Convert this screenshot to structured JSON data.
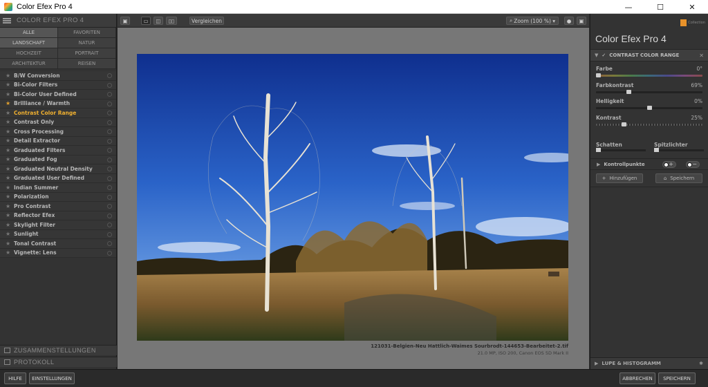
{
  "window": {
    "title": "Color Efex Pro 4",
    "minimize": "—",
    "maximize": "☐",
    "close": "✕"
  },
  "left": {
    "header": "COLOR EFEX PRO 4",
    "categories": [
      {
        "label": "ALLE",
        "active": true
      },
      {
        "label": "FAVORITEN",
        "active": false
      },
      {
        "label": "LANDSCHAFT",
        "active": true
      },
      {
        "label": "NATUR",
        "active": false
      },
      {
        "label": "HOCHZEIT",
        "active": false
      },
      {
        "label": "PORTRAIT",
        "active": false
      },
      {
        "label": "ARCHITEKTUR",
        "active": false
      },
      {
        "label": "REISEN",
        "active": false
      }
    ],
    "filters": [
      {
        "label": "B/W Conversion",
        "fav": false
      },
      {
        "label": "Bi-Color Filters",
        "fav": false
      },
      {
        "label": "Bi-Color User Defined",
        "fav": false
      },
      {
        "label": "Brilliance / Warmth",
        "fav": true
      },
      {
        "label": "Contrast Color Range",
        "fav": false,
        "selected": true
      },
      {
        "label": "Contrast Only",
        "fav": false
      },
      {
        "label": "Cross Processing",
        "fav": false
      },
      {
        "label": "Detail Extractor",
        "fav": false
      },
      {
        "label": "Graduated Filters",
        "fav": false
      },
      {
        "label": "Graduated Fog",
        "fav": false
      },
      {
        "label": "Graduated Neutral Density",
        "fav": false
      },
      {
        "label": "Graduated User Defined",
        "fav": false
      },
      {
        "label": "Indian Summer",
        "fav": false
      },
      {
        "label": "Polarization",
        "fav": false
      },
      {
        "label": "Pro Contrast",
        "fav": false
      },
      {
        "label": "Reflector Efex",
        "fav": false
      },
      {
        "label": "Skylight Filter",
        "fav": false
      },
      {
        "label": "Sunlight",
        "fav": false
      },
      {
        "label": "Tonal Contrast",
        "fav": false
      },
      {
        "label": "Vignette: Lens",
        "fav": false
      }
    ],
    "footer_recipes": "ZUSAMMENSTELLUNGEN",
    "footer_history": "PROTOKOLL"
  },
  "toolbar": {
    "compare": "Vergleichen",
    "zoom": "Zoom (100 %)"
  },
  "image": {
    "filename": "121031-Belgien-Neu Hattlich-Waimes Sourbrodt-144653-Bearbeitet-2.tif",
    "meta": "21.0 MP, ISO 200, Canon EOS 5D Mark II"
  },
  "right": {
    "badge": "Collection",
    "product": "Color Efex Pro",
    "version": "4",
    "filter_title": "CONTRAST COLOR RANGE",
    "params": [
      {
        "label": "Farbe",
        "value": "0°",
        "fraction": 0.0,
        "track": "hue"
      },
      {
        "label": "Farbkontrast",
        "value": "69%",
        "fraction": 0.3,
        "track": "plain"
      },
      {
        "label": "Helligkeit",
        "value": "0%",
        "fraction": 0.5,
        "track": "plain"
      },
      {
        "label": "Kontrast",
        "value": "25%",
        "fraction": 0.25,
        "track": "dotted"
      }
    ],
    "shadows": "Schatten",
    "highlights": "Spitzlichter",
    "control_points": "Kontrollpunkte",
    "add": "Hinzufügen",
    "save": "Speichern",
    "loupe": "LUPE & HISTOGRAMM"
  },
  "bottom": {
    "help": "HILFE",
    "settings": "EINSTELLUNGEN",
    "cancel": "ABBRECHEN",
    "save": "SPEICHERN"
  }
}
